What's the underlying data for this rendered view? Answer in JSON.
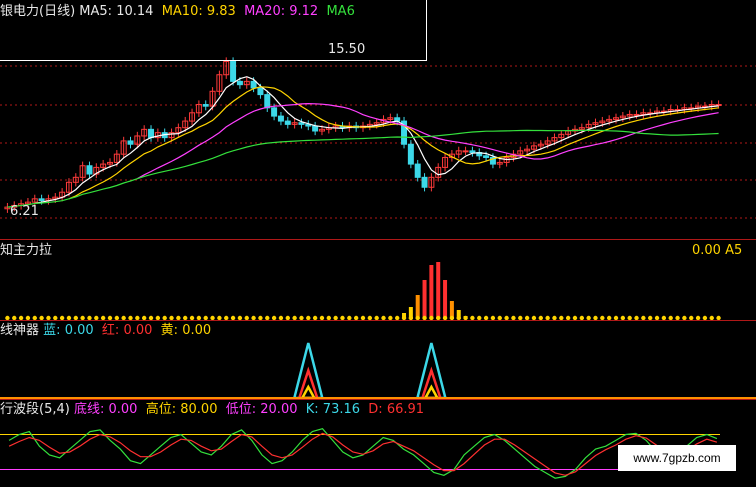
{
  "panel_main": {
    "title": "银电力(日线)",
    "ma5_label": "MA5:",
    "ma5_value": "10.14",
    "ma10_label": "MA10:",
    "ma10_value": "9.83",
    "ma20_label": "MA20:",
    "ma20_value": "9.12",
    "ma60_label": "MA6",
    "high_marker": "15.50",
    "low_marker": "6.21",
    "right_marker": "0.00 A5"
  },
  "panel_2": {
    "title": "知主力拉"
  },
  "panel_3": {
    "title": "线神器",
    "blue_label": "蓝:",
    "blue_value": "0.00",
    "red_label": "红:",
    "red_value": "0.00",
    "yellow_label": "黄:",
    "yellow_value": "0.00"
  },
  "panel_4": {
    "title": "行波段(5,4)",
    "bottom_label": "底线:",
    "bottom_value": "0.00",
    "high_label": "高位:",
    "high_value": "80.00",
    "low_label": "低位:",
    "low_value": "20.00",
    "k_label": "K:",
    "k_value": "73.16",
    "d_label": "D:",
    "d_value": "66.91"
  },
  "watermark": "www.7gpzb.com",
  "colors": {
    "up": "#ff3a3a",
    "down": "#3cd8e8",
    "ma5": "#ffffff",
    "ma10": "#ffd400",
    "ma20": "#ff40ff",
    "ma60": "#34e03c",
    "sep": "#b01818"
  },
  "chart_data": [
    {
      "type": "candlestick",
      "title": "银电力(日线)",
      "x": [
        1,
        2,
        3,
        4,
        5,
        6,
        7,
        8,
        9,
        10,
        11,
        12,
        13,
        14,
        15,
        16,
        17,
        18,
        19,
        20,
        21,
        22,
        23,
        24,
        25,
        26,
        27,
        28,
        29,
        30,
        31,
        32,
        33,
        34,
        35,
        36,
        37,
        38,
        39,
        40,
        41,
        42,
        43,
        44,
        45,
        46,
        47,
        48,
        49,
        50,
        51,
        52,
        53,
        54,
        55,
        56,
        57,
        58,
        59,
        60,
        61,
        62,
        63,
        64,
        65,
        66,
        67,
        68,
        69,
        70,
        71,
        72,
        73,
        74,
        75,
        76,
        77,
        78,
        79,
        80,
        81,
        82,
        83,
        84,
        85,
        86,
        87,
        88,
        89,
        90,
        91,
        92,
        93,
        94,
        95,
        96,
        97,
        98,
        99,
        100,
        101,
        102,
        103,
        104,
        105
      ],
      "ylim": [
        5.5,
        16.5
      ],
      "series": [
        {
          "name": "open",
          "values": [
            6.3,
            6.4,
            6.5,
            6.6,
            6.7,
            6.9,
            6.8,
            6.9,
            7.0,
            7.3,
            7.9,
            8.2,
            8.9,
            8.4,
            8.8,
            9.0,
            9.1,
            9.6,
            10.4,
            10.2,
            10.7,
            11.1,
            10.6,
            10.9,
            10.6,
            10.9,
            11.2,
            11.6,
            12.1,
            12.6,
            12.5,
            13.4,
            14.4,
            15.2,
            14.0,
            13.8,
            14.0,
            13.6,
            13.2,
            12.4,
            11.9,
            11.6,
            11.4,
            11.5,
            11.4,
            11.3,
            11.0,
            11.1,
            11.2,
            11.3,
            11.2,
            11.3,
            11.2,
            11.3,
            11.4,
            11.5,
            11.7,
            11.8,
            11.6,
            10.2,
            9.0,
            8.2,
            7.6,
            8.2,
            8.8,
            9.4,
            9.6,
            9.8,
            9.8,
            9.7,
            9.5,
            9.4,
            9.0,
            9.1,
            9.4,
            9.6,
            9.8,
            9.9,
            10.1,
            10.2,
            10.4,
            10.6,
            10.8,
            11.0,
            11.1,
            11.2,
            11.4,
            11.5,
            11.6,
            11.7,
            11.8,
            11.9,
            12.0,
            12.0,
            12.1,
            12.1,
            12.2,
            12.2,
            12.3,
            12.3,
            12.4,
            12.4,
            12.5,
            12.5,
            12.6
          ]
        },
        {
          "name": "close",
          "values": [
            6.4,
            6.5,
            6.6,
            6.7,
            6.9,
            6.8,
            6.9,
            7.0,
            7.3,
            7.9,
            8.2,
            8.9,
            8.4,
            8.8,
            9.0,
            9.1,
            9.6,
            10.4,
            10.2,
            10.7,
            11.1,
            10.6,
            10.9,
            10.6,
            10.9,
            11.2,
            11.6,
            12.1,
            12.6,
            12.5,
            13.4,
            14.4,
            15.2,
            14.0,
            13.8,
            14.0,
            13.6,
            13.2,
            12.4,
            11.9,
            11.6,
            11.4,
            11.5,
            11.4,
            11.3,
            11.0,
            11.1,
            11.2,
            11.3,
            11.2,
            11.3,
            11.2,
            11.3,
            11.4,
            11.5,
            11.7,
            11.8,
            11.6,
            10.2,
            9.0,
            8.2,
            7.6,
            8.2,
            8.8,
            9.4,
            9.6,
            9.8,
            9.8,
            9.7,
            9.5,
            9.4,
            9.0,
            9.1,
            9.4,
            9.6,
            9.8,
            9.9,
            10.1,
            10.2,
            10.4,
            10.6,
            10.8,
            11.0,
            11.1,
            11.2,
            11.4,
            11.5,
            11.6,
            11.7,
            11.8,
            11.9,
            12.0,
            12.0,
            12.1,
            12.1,
            12.2,
            12.2,
            12.3,
            12.3,
            12.4,
            12.4,
            12.5,
            12.5,
            12.6,
            12.6
          ]
        }
      ],
      "ma_values": {
        "MA5": 10.14,
        "MA10": 9.83,
        "MA20": 9.12
      },
      "annotations": [
        "15.50",
        "6.21"
      ]
    },
    {
      "type": "bar",
      "title": "知主力拉",
      "values": [
        0,
        0,
        0,
        0,
        0,
        0,
        0,
        0,
        0,
        0,
        0,
        0,
        0,
        0,
        0,
        0,
        0,
        0,
        0,
        0,
        0,
        0,
        0,
        0,
        0,
        0,
        0,
        0,
        0,
        0,
        0,
        0,
        0,
        0,
        0,
        0,
        0,
        0,
        0,
        0,
        0,
        0,
        0,
        0,
        0,
        0,
        0,
        0,
        0,
        0,
        0,
        0,
        0,
        0,
        0,
        0,
        0,
        0,
        2,
        4,
        8,
        13,
        18,
        19,
        13,
        6,
        3,
        1,
        0,
        0,
        0,
        0,
        0,
        0,
        0,
        0,
        0,
        0,
        0,
        0,
        0,
        0,
        0,
        0,
        0,
        0,
        0,
        0,
        0,
        0,
        0,
        0,
        0,
        0,
        0,
        0,
        0,
        0,
        0,
        0,
        0,
        0,
        0,
        0,
        0
      ]
    },
    {
      "type": "area",
      "title": "线神器",
      "series": [
        {
          "name": "蓝",
          "peaks": [
            {
              "x": 44,
              "height": 1.0
            },
            {
              "x": 62,
              "height": 1.0
            }
          ]
        },
        {
          "name": "红",
          "peaks": [
            {
              "x": 44,
              "height": 0.5
            },
            {
              "x": 62,
              "height": 0.5
            }
          ]
        },
        {
          "name": "黄",
          "peaks": [
            {
              "x": 44,
              "height": 0.2
            },
            {
              "x": 62,
              "height": 0.2
            }
          ]
        }
      ],
      "values_now": {
        "蓝": 0.0,
        "红": 0.0,
        "黄": 0.0
      }
    },
    {
      "type": "line",
      "title": "行波段(5,4)",
      "ylim": [
        -5,
        105
      ],
      "series": [
        {
          "name": "K",
          "values": [
            70,
            80,
            85,
            60,
            45,
            40,
            55,
            70,
            85,
            88,
            70,
            55,
            35,
            30,
            45,
            60,
            75,
            80,
            65,
            50,
            45,
            60,
            80,
            88,
            70,
            45,
            30,
            35,
            50,
            70,
            85,
            90,
            70,
            50,
            40,
            45,
            60,
            75,
            70,
            55,
            45,
            30,
            15,
            10,
            20,
            45,
            60,
            75,
            80,
            70,
            55,
            40,
            25,
            15,
            5,
            8,
            20,
            40,
            55,
            60,
            70,
            80,
            82,
            70,
            50,
            40,
            45,
            60,
            75,
            80,
            73
          ]
        },
        {
          "name": "D",
          "values": [
            60,
            68,
            75,
            70,
            58,
            48,
            50,
            60,
            72,
            80,
            76,
            66,
            52,
            42,
            42,
            50,
            62,
            72,
            70,
            60,
            52,
            55,
            68,
            80,
            76,
            60,
            45,
            40,
            45,
            58,
            72,
            82,
            76,
            62,
            50,
            46,
            52,
            64,
            68,
            60,
            52,
            40,
            28,
            18,
            18,
            30,
            46,
            62,
            72,
            72,
            62,
            50,
            38,
            26,
            14,
            10,
            16,
            30,
            44,
            54,
            62,
            72,
            78,
            74,
            62,
            50,
            46,
            52,
            64,
            72,
            66.91
          ]
        }
      ],
      "levels": {
        "底线": 0.0,
        "高位": 80.0,
        "低位": 20.0
      },
      "values_now": {
        "K": 73.16,
        "D": 66.91
      }
    }
  ]
}
